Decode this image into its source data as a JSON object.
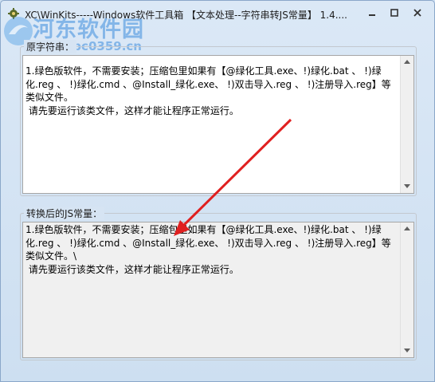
{
  "window": {
    "title": "XC\\WinKits-----Windows软件工具箱 【文本处理--字符串转JS常量】 1.4....",
    "minimize_glyph": "–",
    "restore_glyph": "▫",
    "close_glyph": "✕"
  },
  "watermark": {
    "text": "河东软件园",
    "url": "www.pc0359.cn"
  },
  "source_group": {
    "label": "原字符串：",
    "text": "1.绿色版软件，不需要安装；压缩包里如果有【@绿化工具.exe、!)绿化.bat 、 !)绿化.reg 、 !)绿化.cmd 、@Install_绿化.exe、 !)双击导入.reg 、 !)注册导入.reg】等类似文件。\n 请先要运行该类文件，这样才能让程序正常运行。"
  },
  "result_group": {
    "label": "转换后的JS常量：",
    "text": "1.绿色版软件，不需要安装；压缩包里如果有【@绿化工具.exe、!)绿化.bat 、 !)绿化.reg 、 !)绿化.cmd 、@Install_绿化.exe、 !)双击导入.reg 、 !)注册导入.reg】等类似文件。\\\n 请先要运行该类文件，这样才能让程序正常运行。"
  },
  "colors": {
    "arrow": "#e02020",
    "title_bg": "#dbe8f6"
  }
}
